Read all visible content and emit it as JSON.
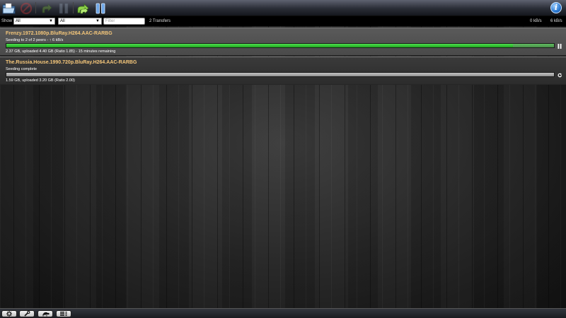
{
  "toolbar": {
    "buttons": [
      {
        "name": "open-torrent",
        "icon": "folder-icon",
        "enabled": true
      },
      {
        "name": "remove-torrent",
        "icon": "no-entry-icon",
        "enabled": false
      },
      {
        "name": "resume-selected",
        "icon": "resume-arrow-icon",
        "enabled": false
      },
      {
        "name": "pause-selected",
        "icon": "pause-icon",
        "enabled": false
      },
      {
        "name": "resume-all",
        "icon": "resume-all-icon",
        "enabled": true
      },
      {
        "name": "pause-all",
        "icon": "pause-all-icon",
        "enabled": true
      }
    ],
    "info_icon": "i"
  },
  "filter": {
    "show_label": "Show",
    "status_select": "All",
    "tracker_select": "All",
    "search_placeholder": "Filter",
    "count": "2 Transfers",
    "download_speed": "0 kB/s",
    "upload_speed": "6 kB/s"
  },
  "torrents": [
    {
      "name": "Frenzy.1972.1080p.BluRay.H264.AAC-RARBG",
      "status": "Seeding to 2 of 2 peers - ↑ 6 kB/s",
      "progress_text": "2.37 GB, uploaded 4.40 GB (Ratio 1.85) - 15 minutes remaining",
      "seed_ratio_progress": 0.925,
      "state": "seeding",
      "control": "pause-icon"
    },
    {
      "name": "The.Russia.House.1990.720p.BluRay.H264.AAC-RARBG",
      "status": "Seeding complete",
      "progress_text": "1.59 GB, uploaded 3.20 GB (Ratio 2.00)",
      "seed_ratio_progress": 1.0,
      "state": "complete",
      "control": "resume-icon"
    }
  ],
  "bottom": {
    "buttons": [
      {
        "name": "settings",
        "icon": "gear-icon"
      },
      {
        "name": "preferences",
        "icon": "wrench-icon"
      },
      {
        "name": "turtle-mode",
        "icon": "turtle-icon"
      },
      {
        "name": "compact-view",
        "icon": "list-icon"
      }
    ]
  },
  "colors": {
    "torrent_name": "#f5c77a",
    "seed_bar": "#2fc22f",
    "complete_bar": "#a8a8a8"
  }
}
